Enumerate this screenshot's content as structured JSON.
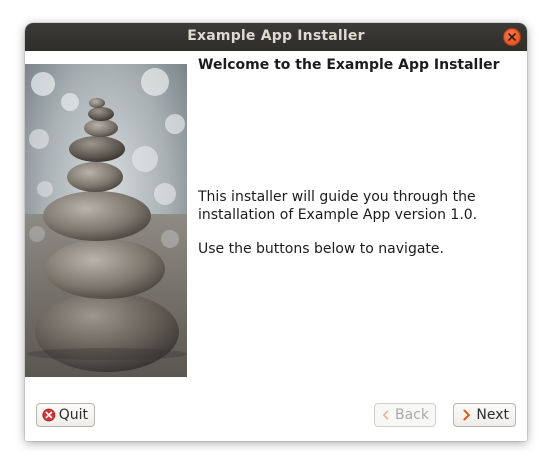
{
  "window": {
    "title": "Example App Installer"
  },
  "page": {
    "heading": "Welcome to the Example App Installer",
    "paragraph_line1": "This installer will guide you through the",
    "paragraph_line2": "installation of Example App version 1.0.",
    "paragraph_line3": "Use the buttons below to navigate."
  },
  "buttons": {
    "quit_label": "Quit",
    "back_label": "Back",
    "next_label": "Next",
    "back_enabled": false
  },
  "icons": {
    "close": "close-icon",
    "quit": "quit-icon",
    "back": "chevron-left-icon",
    "next": "chevron-right-icon"
  },
  "colors": {
    "titlebar": "#2f2e2b",
    "close_button": "#df4a16",
    "quit_icon": "#d43232",
    "next_icon": "#e25a1c"
  }
}
